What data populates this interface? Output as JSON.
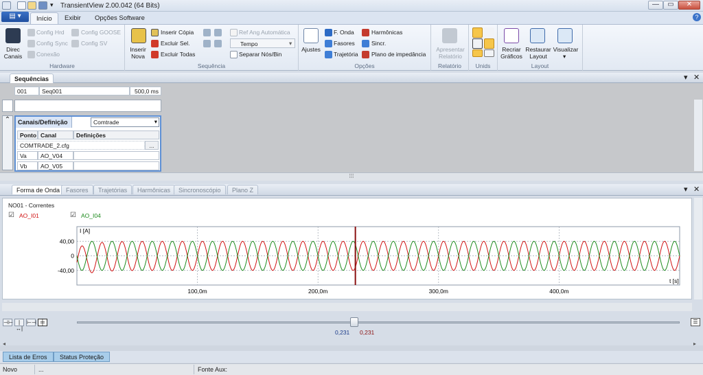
{
  "window": {
    "title": "TransientView 2.00.042 (64 Bits)",
    "minimize": "—",
    "maximize": "▭",
    "close": "✕"
  },
  "ribbon_tabs": [
    "Início",
    "Exibir",
    "Opções Software"
  ],
  "ribbon": {
    "hardware": {
      "label": "Hardware",
      "direc": "Direc\nCanais",
      "config_hrd": "Config Hrd",
      "config_sync": "Config Sync",
      "conexao": "Conexão",
      "config_goose": "Config GOOSE",
      "config_sv": "Config SV"
    },
    "sequencia": {
      "label": "Sequência",
      "inserir_nova": "Inserir\nNova",
      "inserir_copia": "Inserir Cópia",
      "excluir_sel": "Excluir Sel.",
      "excluir_todas": "Excluir Todas",
      "ref_ang": "Ref Ang Automática",
      "tempo": "Tempo",
      "separar": "Separar Nós/Bin"
    },
    "opcoes": {
      "label": "Opções",
      "ajustes": "Ajustes",
      "f_onda": "F. Onda",
      "fasores": "Fasores",
      "trajetoria": "Trajetória",
      "harmonicas": "Harmônicas",
      "sincr": "Sincr.",
      "plano": "Plano de impedância"
    },
    "relatorio": {
      "label": "Relatório",
      "apresentar": "Apresentar\nRelatório"
    },
    "unids": {
      "label": "Unids"
    },
    "layout": {
      "label": "Layout",
      "recriar": "Recriar\nGráficos",
      "restaurar": "Restaurar\nLayout",
      "visualizar": "Visualizar"
    }
  },
  "sequencias": {
    "tab": "Sequências",
    "row": {
      "num": "001",
      "name": "Seq001",
      "time": "500,0 ms"
    },
    "canais_tab": "Canais/Definição",
    "format": "Comtrade",
    "columns": [
      "Ponto",
      "Canal",
      "Definições"
    ],
    "file": "COMTRADE_2.cfg",
    "file_btn": "...",
    "rows": [
      {
        "ponto": "Va",
        "canal": "AO_V04"
      },
      {
        "ponto": "Vb",
        "canal": "AO_V05"
      }
    ]
  },
  "analysis_tabs": [
    "Forma de Onda",
    "Fasores",
    "Trajetórias",
    "Harmônicas",
    "Sincronoscópio",
    "Plano Z"
  ],
  "plot": {
    "group_title": "NO01 - Correntes",
    "legend": [
      {
        "name": "AO_I01",
        "color": "#d01010",
        "checked": "☑"
      },
      {
        "name": "AO_I04",
        "color": "#1c8a1c",
        "checked": "☑"
      }
    ],
    "ylabel": "I [A]",
    "xlabel": "t [s]",
    "yticks": [
      "40,00",
      "0",
      "-40,00"
    ],
    "xticks": [
      "100,0m",
      "200,0m",
      "300,0m",
      "400,0m"
    ],
    "cursor_values": [
      "0,231",
      "0,231"
    ]
  },
  "chart_data": {
    "type": "line",
    "xlabel": "t [s]",
    "ylabel": "I [A]",
    "xlim": [
      0,
      0.5
    ],
    "ylim": [
      -80,
      80
    ],
    "cursor_x": 0.231,
    "series": [
      {
        "name": "AO_I01",
        "color": "#d01010",
        "amplitude": 40,
        "frequency_hz": 60,
        "phase_deg": 0,
        "initial_transient": "offset decaying in first cycle"
      },
      {
        "name": "AO_I04",
        "color": "#1c8a1c",
        "amplitude": 40,
        "frequency_hz": 60,
        "phase_deg": 180
      }
    ]
  },
  "bottom_tabs": [
    "Lista de Erros",
    "Status Proteção"
  ],
  "statusbar": {
    "mode": "Novo",
    "dots": "...",
    "fonte": "Fonte Aux:"
  }
}
